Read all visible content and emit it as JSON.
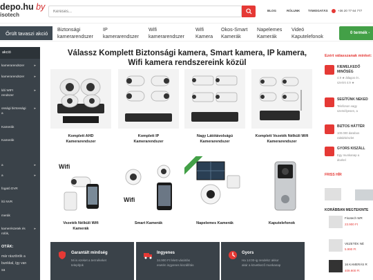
{
  "header": {
    "logo_main": "depo.hu",
    "logo_by": "by",
    "logo_sub": "isotech",
    "search_placeholder": "Keresés...",
    "links": [
      "BLOG",
      "RÓLUNK",
      "TÁMOGATÁS"
    ],
    "phone": "+36 20 77 64 777"
  },
  "nav": {
    "promo": "Őrült tavaszi akció",
    "items": [
      [
        "Biztonsági",
        "kamerarendszer"
      ],
      [
        "IP",
        "kamerarendszer"
      ],
      [
        "Wifi",
        "kamerarendszer"
      ],
      [
        "Wifi",
        "Kamera"
      ],
      [
        "Okos-Smart",
        "Kamerák"
      ],
      [
        "Napelemes",
        "Kamerák"
      ],
      [
        "Videó",
        "Kaputelefonok"
      ]
    ],
    "cart": "0 termék -"
  },
  "sidebar": {
    "header": "akció",
    "items": [
      "kamerarendszer",
      "kamerarendszer",
      "ldó WIFI",
      "rendszer",
      "onsági biztonsági",
      "a",
      "Kamerák",
      "Kamerák",
      "a",
      "a",
      "fogató DVR",
      "ító NVR",
      "merák",
      "kamerészetek és",
      "rolók,"
    ],
    "bottom_title": "OTÁK:",
    "bottom_lines": [
      "már rásztörök a",
      "bunkkal, így van",
      "sa"
    ]
  },
  "main": {
    "title_line1": "Válassz Komplett Biztonsági kamera, Smart kamera, IP kamera,",
    "title_line2": "Wifi kamera rendszereink közül",
    "cards": [
      {
        "label1": "Komplett AHD",
        "label2": "Kamerarendszer",
        "ribbon": ""
      },
      {
        "label1": "Komplett IP",
        "label2": "Kamerarendszer",
        "ribbon": ""
      },
      {
        "label1": "Nagy Látótávolságú",
        "label2": "Kamerarendszer",
        "ribbon": ""
      },
      {
        "label1": "Komplett Vezeték Nélküli Wifi",
        "label2": "Kamerarendszer",
        "ribbon": ""
      },
      {
        "label1": "Vezeték Nélküli Wifi",
        "label2": "Kamerák",
        "ribbon": ""
      },
      {
        "label1": "Smart Kamerák",
        "label2": "",
        "ribbon": ""
      },
      {
        "label1": "Napelemes Kamerák",
        "label2": "",
        "ribbon": ""
      },
      {
        "label1": "Kaputelefonok",
        "label2": "",
        "ribbon": ""
      }
    ],
    "wifi_tag": "Wifi",
    "benefits": [
      {
        "title": "Garantált minőség",
        "text1": "Mi is ezeket a termékeket",
        "text2": "telepítjük"
      },
      {
        "title": "Ingyenes",
        "text1": "34.900 Ft felett vásárlás",
        "text2": "esetén ingyenes kiszállítás"
      },
      {
        "title": "Gyors",
        "text1": "Ha 14:00-ig rendelsz akkor",
        "text2": "akár a következő munkanap"
      }
    ]
  },
  "right": {
    "header": "Ezért válasszanak minket:",
    "items": [
      {
        "title": "KIEMELKEDŐ",
        "title2": "MINŐSÉG",
        "text1": "4.9 ★ átlagos ér..",
        "text2": "szerint 4.9 ★"
      },
      {
        "title": "SEGÍTÜNK NEKED",
        "title2": "",
        "text1": "Telefonon vagy",
        "text2": "személyesen, a"
      },
      {
        "title": "BIZTOS HÁTTÉR",
        "title2": "",
        "text1": "100.000 darabos",
        "text2": "raktárkészlet"
      },
      {
        "title": "GYORS KISZÁLL",
        "title2": "",
        "text1": "Egy munkanap a",
        "text2": "átvétel"
      }
    ],
    "free_label": "FRISS HÍR",
    "recent_header": "KORÁBBAN MEGTEKINTE",
    "products": [
      {
        "name": "Fisotech WR",
        "price": "23.900 Ft"
      },
      {
        "name": "VEZETÉK NÉ",
        "price": "5.990 Ft"
      },
      {
        "name": "16 KAMERÁS R",
        "price": "409.900 Ft"
      }
    ]
  }
}
